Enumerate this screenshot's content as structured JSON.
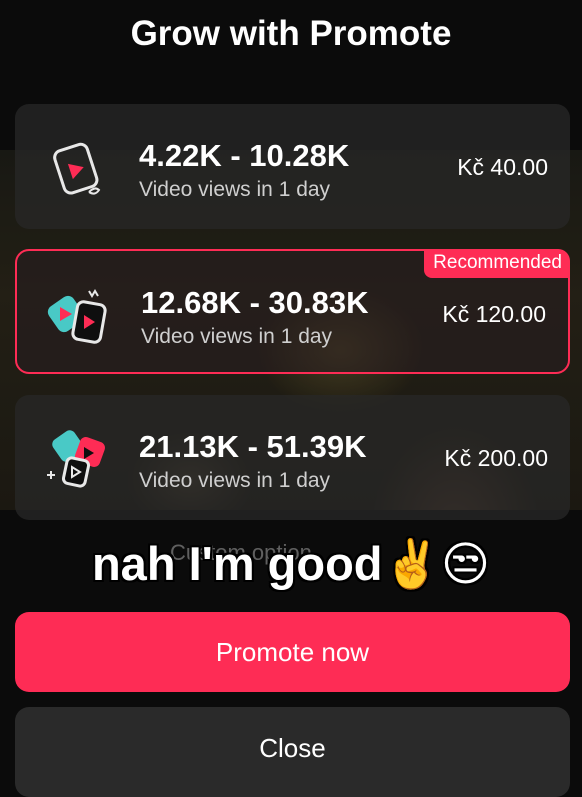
{
  "header": {
    "title": "Grow with Promote"
  },
  "options": [
    {
      "range": "4.22K - 10.28K",
      "subtitle": "Video views in 1 day",
      "price": "Kč 40.00",
      "icon": "play-card-icon"
    },
    {
      "range": "12.68K - 30.83K",
      "subtitle": "Video views in 1 day",
      "price": "Kč 120.00",
      "badge": "Recommended",
      "icon": "play-cards-icon"
    },
    {
      "range": "21.13K - 51.39K",
      "subtitle": "Video views in 1 day",
      "price": "Kč 200.00",
      "icon": "play-cards-sparkle-icon"
    }
  ],
  "overlay": {
    "caption": "nah I'm good✌️😒",
    "partial_link": "Custom option"
  },
  "buttons": {
    "promote": "Promote now",
    "close": "Close"
  },
  "colors": {
    "accent": "#fe2c55",
    "teal": "#49c9c6",
    "background": "#0b0b0b"
  }
}
